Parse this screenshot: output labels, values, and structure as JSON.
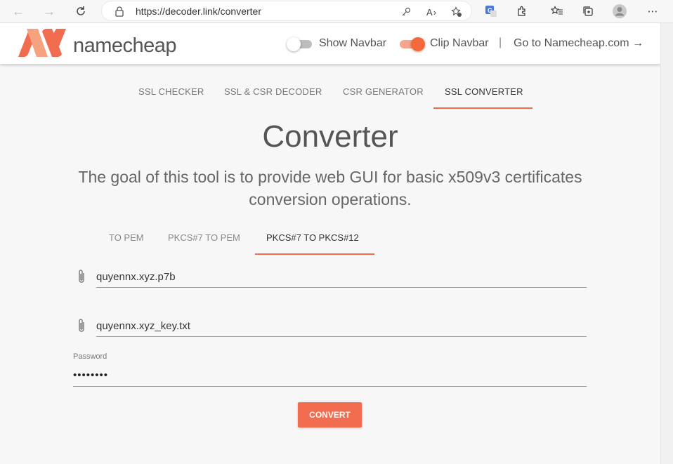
{
  "browser": {
    "url": "https://decoder.link/converter",
    "back_icon": "arrow-left-icon",
    "forward_icon": "arrow-right-icon",
    "reload_icon": "reload-icon"
  },
  "header": {
    "logo_text": "namecheap",
    "show_navbar_label": "Show Navbar",
    "show_navbar_on": false,
    "clip_navbar_label": "Clip Navbar",
    "clip_navbar_on": true,
    "separator": "|",
    "goto_link": "Go to Namecheap.com →"
  },
  "tool_tabs": [
    {
      "label": "SSL CHECKER",
      "active": false
    },
    {
      "label": "SSL & CSR DECODER",
      "active": false
    },
    {
      "label": "CSR GENERATOR",
      "active": false
    },
    {
      "label": "SSL CONVERTER",
      "active": true
    }
  ],
  "main": {
    "title": "Converter",
    "description": "The goal of this tool is to provide web GUI for basic x509v3 certificates conversion operations."
  },
  "converter_tabs": [
    {
      "label": "TO PEM",
      "active": false
    },
    {
      "label": "PKCS#7 TO PEM",
      "active": false
    },
    {
      "label": "PKCS#7 TO PKCS#12",
      "active": true
    }
  ],
  "form": {
    "file1": "quyennx.xyz.p7b",
    "file2": "quyennx.xyz_key.txt",
    "password_label": "Password",
    "password_value": "••••••••",
    "convert_label": "CONVERT"
  },
  "colors": {
    "accent": "#f26c4f",
    "toggle_on": "#f5683a"
  }
}
